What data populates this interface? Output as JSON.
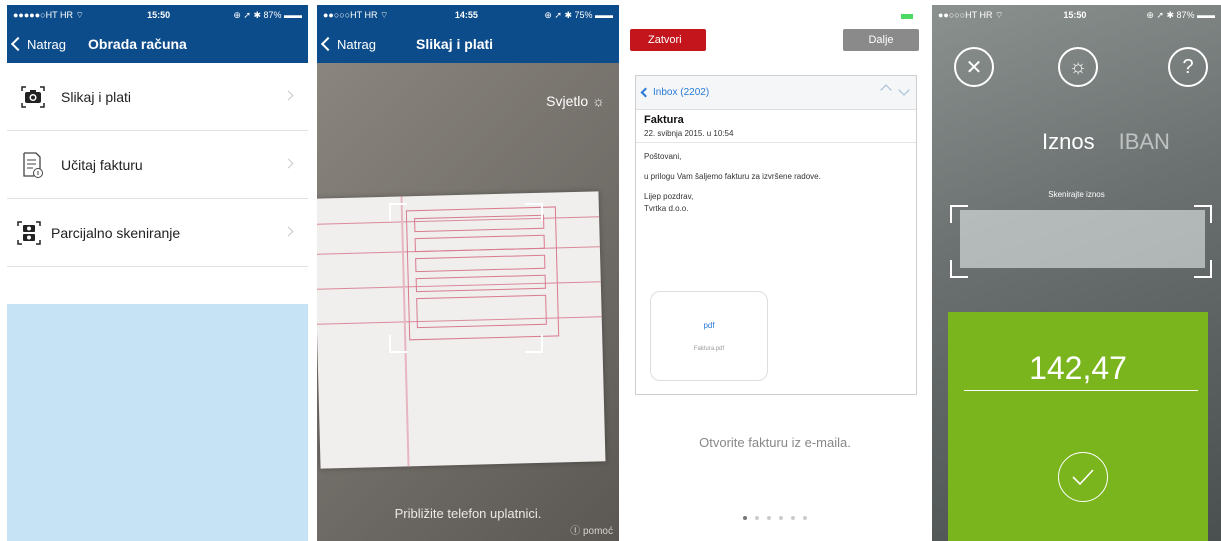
{
  "screen1": {
    "status": {
      "left": "●●●●●○HT HR ⌔",
      "time": "15:50",
      "right": "⊕ ➚ ✱ 87% ▬▬"
    },
    "nav": {
      "back": "Natrag",
      "title": "Obrada računa"
    },
    "items": [
      {
        "label": "Slikaj i plati",
        "icon": "camera-icon"
      },
      {
        "label": "Učitaj fakturu",
        "icon": "document-icon"
      },
      {
        "label": "Parcijalno skeniranje",
        "icon": "scan-icon"
      }
    ],
    "colors": {
      "nav": "#0d4c8a",
      "fill": "#c6e3f5"
    }
  },
  "screen2": {
    "status": {
      "left": "●●○○○HT HR ⌔",
      "time": "14:55",
      "right": "⊕ ➚ ✱ 75% ▬▬"
    },
    "nav": {
      "back": "Natrag",
      "title": "Slikaj i plati"
    },
    "light": "Svjetlo",
    "hint": "Približite telefon uplatnici.",
    "help": "Ⓘ pomoć"
  },
  "screen3": {
    "close": "Zatvori",
    "next": "Dalje",
    "mail": {
      "back": "Inbox (2202)",
      "subject": "Faktura",
      "date": "22. svibnja 2015. u 10:54",
      "body": [
        "Poštovani,",
        "u prilogu Vam šaljemo fakturu za izvršene radove.",
        "Lijep pozdrav,\nTvrtka d.o.o."
      ],
      "attachment_type": "pdf",
      "attachment_name": "Faktura.pdf"
    },
    "instruction": "Otvorite fakturu iz e-maila.",
    "page_count": 6,
    "current_page": 1
  },
  "screen4": {
    "status": {
      "left": "●●○○○HT HR ⌔",
      "time": "15:50",
      "right": "⊕ ➚ ✱ 87% ▬▬"
    },
    "tabs": [
      "Iznos",
      "IBAN"
    ],
    "scan_label": "Skenirajte iznos",
    "amount": "142,47",
    "colors": {
      "green": "#7ab51d"
    }
  }
}
